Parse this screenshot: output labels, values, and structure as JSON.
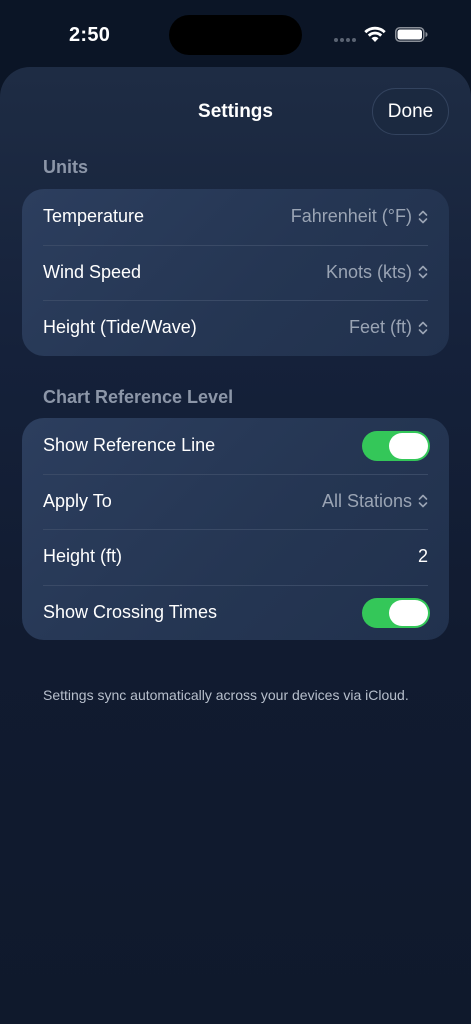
{
  "status_bar": {
    "time": "2:50"
  },
  "sheet": {
    "title": "Settings",
    "done_label": "Done"
  },
  "units": {
    "header": "Units",
    "rows": [
      {
        "label": "Temperature",
        "value": "Fahrenheit (°F)"
      },
      {
        "label": "Wind Speed",
        "value": "Knots (kts)"
      },
      {
        "label": "Height (Tide/Wave)",
        "value": "Feet (ft)"
      }
    ]
  },
  "chart_reference": {
    "header": "Chart Reference Level",
    "show_reference_line": {
      "label": "Show Reference Line",
      "on": true
    },
    "apply_to": {
      "label": "Apply To",
      "value": "All Stations"
    },
    "height": {
      "label": "Height (ft)",
      "value": "2"
    },
    "show_crossing_times": {
      "label": "Show Crossing Times",
      "on": true
    }
  },
  "footer_note": "Settings sync automatically across your devices via iCloud.",
  "colors": {
    "toggle_on": "#34c759",
    "background": "#0b1526"
  },
  "icons": [
    "wifi-icon",
    "battery-icon",
    "chevron-updown-icon"
  ]
}
